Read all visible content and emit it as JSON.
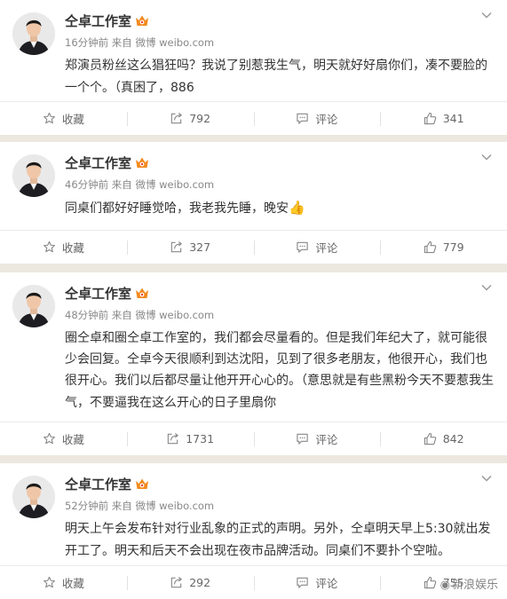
{
  "feed": [
    {
      "user": "仝卓工作室",
      "time": "16分钟前",
      "source_prefix": "来自",
      "source": "微博 weibo.com",
      "text": "郑演员粉丝这么猖狂吗？我说了别惹我生气，明天就好好扇你们，凑不要脸的一个个。（真困了，886",
      "emoji": "",
      "collect_label": "收藏",
      "repost_count": "792",
      "comment_label": "评论",
      "like_count": "341"
    },
    {
      "user": "仝卓工作室",
      "time": "46分钟前",
      "source_prefix": "来自",
      "source": "微博 weibo.com",
      "text": "同桌们都好好睡觉哈，我老我先睡，晚安",
      "emoji": "👍",
      "collect_label": "收藏",
      "repost_count": "327",
      "comment_label": "评论",
      "like_count": "779"
    },
    {
      "user": "仝卓工作室",
      "time": "48分钟前",
      "source_prefix": "来自",
      "source": "微博 weibo.com",
      "text": "圈仝卓和圈仝卓工作室的，我们都会尽量看的。但是我们年纪大了，就可能很少会回复。仝卓今天很顺利到达沈阳，见到了很多老朋友，他很开心，我们也很开心。我们以后都尽量让他开开心心的。（意思就是有些黑粉今天不要惹我生气，不要逼我在这么开心的日子里扇你",
      "emoji": "",
      "collect_label": "收藏",
      "repost_count": "1731",
      "comment_label": "评论",
      "like_count": "842"
    },
    {
      "user": "仝卓工作室",
      "time": "52分钟前",
      "source_prefix": "来自",
      "source": "微博 weibo.com",
      "text": "明天上午会发布针对行业乱象的正式的声明。另外，仝卓明天早上5:30就出发开工了。明天和后天不会出现在夜市品牌活动。同桌们不要扑个空啦。",
      "emoji": "",
      "collect_label": "收藏",
      "repost_count": "292",
      "comment_label": "评论",
      "like_count": "755"
    }
  ],
  "watermark": "新浪娱乐",
  "colors": {
    "page_bg": "#ece8df",
    "card_bg": "#ffffff",
    "name_text": "#333333",
    "meta_text": "#888888",
    "vip_badge": "#f28a1f"
  }
}
